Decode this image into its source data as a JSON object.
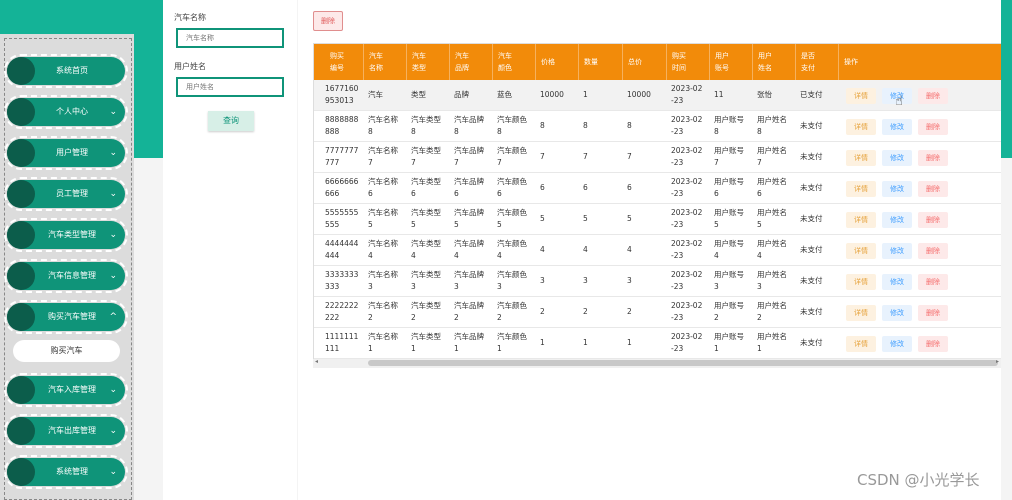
{
  "sidebar": {
    "items": [
      {
        "label": "系统首页",
        "chevron": ""
      },
      {
        "label": "个人中心",
        "chevron": "⌄"
      },
      {
        "label": "用户管理",
        "chevron": "⌄"
      },
      {
        "label": "员工管理",
        "chevron": "⌄"
      },
      {
        "label": "汽车类型管理",
        "chevron": "⌄"
      },
      {
        "label": "汽车信息管理",
        "chevron": "⌄"
      },
      {
        "label": "购买汽车管理",
        "chevron": "^"
      },
      {
        "label": "汽车入库管理",
        "chevron": "⌄"
      },
      {
        "label": "汽车出库管理",
        "chevron": "⌄"
      },
      {
        "label": "系统管理",
        "chevron": "⌄"
      }
    ],
    "submenu": "购买汽车"
  },
  "search": {
    "car_name_label": "汽车名称",
    "car_name_placeholder": "汽车名称",
    "user_name_label": "用户姓名",
    "user_name_placeholder": "用户姓名",
    "query_button": "查询"
  },
  "toolbar": {
    "delete_label": "删除"
  },
  "table": {
    "headers": [
      [
        "购买",
        "编号"
      ],
      [
        "汽车",
        "名称"
      ],
      [
        "汽车",
        "类型"
      ],
      [
        "汽车",
        "品牌"
      ],
      [
        "汽车",
        "颜色"
      ],
      [
        "价格",
        ""
      ],
      [
        "数量",
        ""
      ],
      [
        "总价",
        ""
      ],
      [
        "购买",
        "时间"
      ],
      [
        "用户",
        "账号"
      ],
      [
        "用户",
        "姓名"
      ],
      [
        "是否",
        "支付"
      ],
      [
        "操作",
        ""
      ]
    ],
    "rows": [
      [
        [
          "1677160",
          "953013"
        ],
        [
          "汽车",
          ""
        ],
        [
          "类型",
          ""
        ],
        [
          "品牌",
          ""
        ],
        [
          "蓝色",
          ""
        ],
        [
          "10000",
          ""
        ],
        [
          "1",
          ""
        ],
        [
          "10000",
          ""
        ],
        [
          "2023-02",
          "-23"
        ],
        [
          "11",
          ""
        ],
        [
          "张怡",
          ""
        ],
        [
          "已支付",
          ""
        ]
      ],
      [
        [
          "8888888",
          "888"
        ],
        [
          "汽车名称",
          "8"
        ],
        [
          "汽车类型",
          "8"
        ],
        [
          "汽车品牌",
          "8"
        ],
        [
          "汽车颜色",
          "8"
        ],
        [
          "8",
          ""
        ],
        [
          "8",
          ""
        ],
        [
          "8",
          ""
        ],
        [
          "2023-02",
          "-23"
        ],
        [
          "用户账号",
          "8"
        ],
        [
          "用户姓名",
          "8"
        ],
        [
          "未支付",
          ""
        ]
      ],
      [
        [
          "7777777",
          "777"
        ],
        [
          "汽车名称",
          "7"
        ],
        [
          "汽车类型",
          "7"
        ],
        [
          "汽车品牌",
          "7"
        ],
        [
          "汽车颜色",
          "7"
        ],
        [
          "7",
          ""
        ],
        [
          "7",
          ""
        ],
        [
          "7",
          ""
        ],
        [
          "2023-02",
          "-23"
        ],
        [
          "用户账号",
          "7"
        ],
        [
          "用户姓名",
          "7"
        ],
        [
          "未支付",
          ""
        ]
      ],
      [
        [
          "6666666",
          "666"
        ],
        [
          "汽车名称",
          "6"
        ],
        [
          "汽车类型",
          "6"
        ],
        [
          "汽车品牌",
          "6"
        ],
        [
          "汽车颜色",
          "6"
        ],
        [
          "6",
          ""
        ],
        [
          "6",
          ""
        ],
        [
          "6",
          ""
        ],
        [
          "2023-02",
          "-23"
        ],
        [
          "用户账号",
          "6"
        ],
        [
          "用户姓名",
          "6"
        ],
        [
          "未支付",
          ""
        ]
      ],
      [
        [
          "5555555",
          "555"
        ],
        [
          "汽车名称",
          "5"
        ],
        [
          "汽车类型",
          "5"
        ],
        [
          "汽车品牌",
          "5"
        ],
        [
          "汽车颜色",
          "5"
        ],
        [
          "5",
          ""
        ],
        [
          "5",
          ""
        ],
        [
          "5",
          ""
        ],
        [
          "2023-02",
          "-23"
        ],
        [
          "用户账号",
          "5"
        ],
        [
          "用户姓名",
          "5"
        ],
        [
          "未支付",
          ""
        ]
      ],
      [
        [
          "4444444",
          "444"
        ],
        [
          "汽车名称",
          "4"
        ],
        [
          "汽车类型",
          "4"
        ],
        [
          "汽车品牌",
          "4"
        ],
        [
          "汽车颜色",
          "4"
        ],
        [
          "4",
          ""
        ],
        [
          "4",
          ""
        ],
        [
          "4",
          ""
        ],
        [
          "2023-02",
          "-23"
        ],
        [
          "用户账号",
          "4"
        ],
        [
          "用户姓名",
          "4"
        ],
        [
          "未支付",
          ""
        ]
      ],
      [
        [
          "3333333",
          "333"
        ],
        [
          "汽车名称",
          "3"
        ],
        [
          "汽车类型",
          "3"
        ],
        [
          "汽车品牌",
          "3"
        ],
        [
          "汽车颜色",
          "3"
        ],
        [
          "3",
          ""
        ],
        [
          "3",
          ""
        ],
        [
          "3",
          ""
        ],
        [
          "2023-02",
          "-23"
        ],
        [
          "用户账号",
          "3"
        ],
        [
          "用户姓名",
          "3"
        ],
        [
          "未支付",
          ""
        ]
      ],
      [
        [
          "2222222",
          "222"
        ],
        [
          "汽车名称",
          "2"
        ],
        [
          "汽车类型",
          "2"
        ],
        [
          "汽车品牌",
          "2"
        ],
        [
          "汽车颜色",
          "2"
        ],
        [
          "2",
          ""
        ],
        [
          "2",
          ""
        ],
        [
          "2",
          ""
        ],
        [
          "2023-02",
          "-23"
        ],
        [
          "用户账号",
          "2"
        ],
        [
          "用户姓名",
          "2"
        ],
        [
          "未支付",
          ""
        ]
      ],
      [
        [
          "1111111",
          "111"
        ],
        [
          "汽车名称",
          "1"
        ],
        [
          "汽车类型",
          "1"
        ],
        [
          "汽车品牌",
          "1"
        ],
        [
          "汽车颜色",
          "1"
        ],
        [
          "1",
          ""
        ],
        [
          "1",
          ""
        ],
        [
          "1",
          ""
        ],
        [
          "2023-02",
          "-23"
        ],
        [
          "用户账号",
          "1"
        ],
        [
          "用户姓名",
          "1"
        ],
        [
          "未支付",
          ""
        ]
      ]
    ],
    "actions": {
      "detail": "详情",
      "edit": "修改",
      "delete": "删除"
    }
  },
  "scrollbar": {
    "left_arrow": "◂",
    "right_arrow": "▸"
  },
  "watermark": "CSDN @小光学长",
  "colors": {
    "primary": "#0f9479",
    "header_orange": "#f28b0a",
    "detail": "#e6a23c",
    "edit": "#409eff",
    "delete": "#f56c6c"
  }
}
